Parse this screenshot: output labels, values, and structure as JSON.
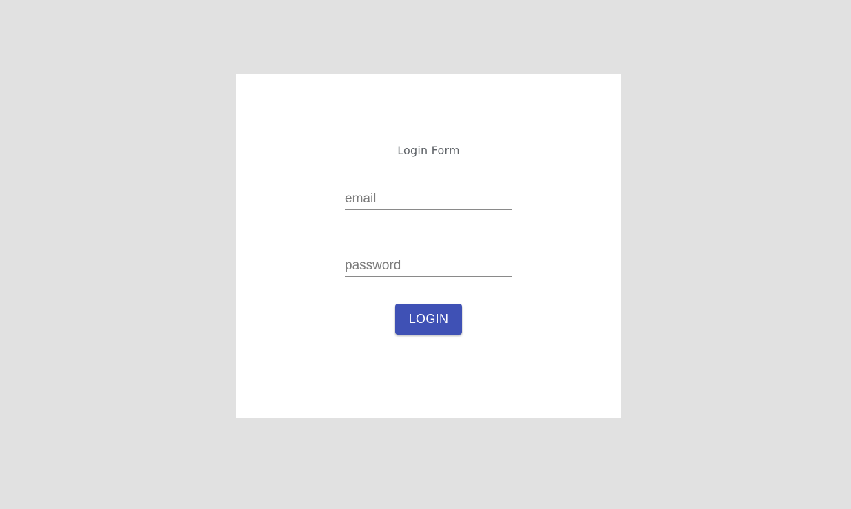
{
  "form": {
    "title": "Login Form",
    "email_placeholder": "email",
    "password_placeholder": "password",
    "login_label": "LOGIN"
  },
  "colors": {
    "page_background": "#e1e1e1",
    "card_background": "#ffffff",
    "button_primary": "#3f51b5"
  }
}
